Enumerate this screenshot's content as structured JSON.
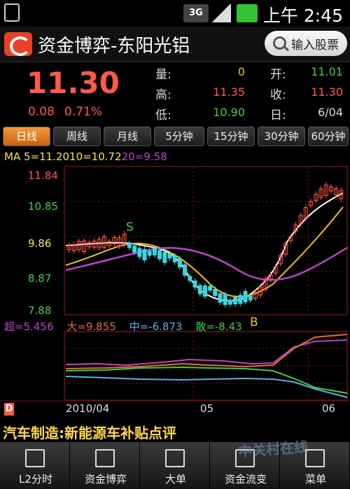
{
  "status_bar": {
    "time": "上午 2:45",
    "network": "3G"
  },
  "header": {
    "title": "资金博弈-东阳光铝",
    "search_label": "输入股票"
  },
  "quote": {
    "price": "11.30",
    "change": "0.08",
    "change_pct": "0.71%",
    "fields": [
      {
        "label": "量:",
        "value": "0",
        "color": "#f2c200"
      },
      {
        "label": "开:",
        "value": "11.01",
        "color": "#3bd23b"
      },
      {
        "label": "高:",
        "value": "11.35",
        "color": "#ff5a4a"
      },
      {
        "label": "收:",
        "value": "11.30",
        "color": "#ff5a4a"
      },
      {
        "label": "低:",
        "value": "10.90",
        "color": "#3bd23b"
      },
      {
        "label": "日:",
        "value": "6/04",
        "color": "#dddddd"
      }
    ]
  },
  "tabs": [
    "日线",
    "周线",
    "月线",
    "5分钟",
    "15分钟",
    "30分钟",
    "60分钟"
  ],
  "ma": {
    "label": "MA 5=11.20",
    "ma10": "10=10.72",
    "ma20": "20=9.58"
  },
  "yticks": [
    "11.84",
    "10.85",
    "9.86",
    "8.87",
    "7.88"
  ],
  "markers": {
    "sell": "S",
    "buy": "B"
  },
  "indicators": {
    "super": "超=5.456",
    "big": "大=9.855",
    "mid": "中=-6.873",
    "retail": "散=-8.43"
  },
  "xlabels": {
    "d": "D",
    "start": "2010/04",
    "mid": "05",
    "end": "06"
  },
  "news": "汽车制造:新能源车补贴点评",
  "bottom_nav": [
    "L2分时",
    "资金博弈",
    "大单",
    "资金流变",
    "菜单"
  ],
  "watermark": "中关村在线",
  "colors": {
    "up": "#ff5a4a",
    "down": "#3bd23b",
    "accent": "#f49a3a",
    "ma5": "#ffffff",
    "ma10": "#f2c200",
    "ma20": "#c040d0"
  }
}
